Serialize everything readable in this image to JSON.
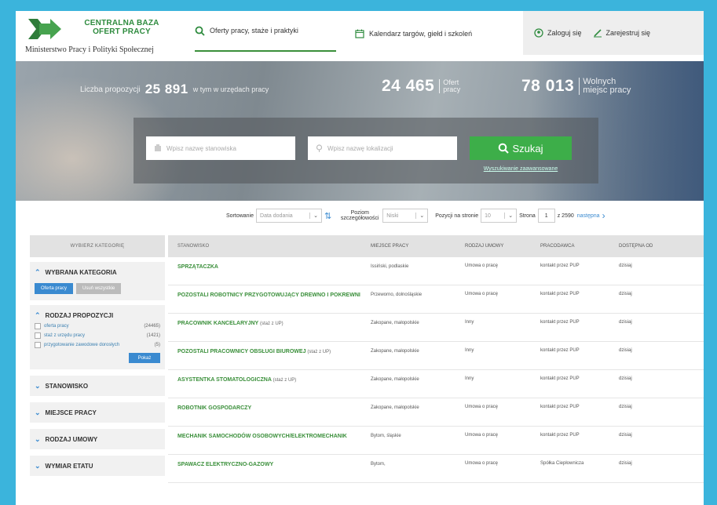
{
  "header": {
    "logo_line1": "CENTRALNA BAZA",
    "logo_line2": "OFERT PRACY",
    "ministry": "Ministerstwo Pracy i Polityki Społecznej",
    "nav_offers": "Oferty pracy, staże i praktyki",
    "nav_calendar": "Kalendarz targów, giełd i szkoleń",
    "login": "Zaloguj się",
    "register": "Zarejestruj się"
  },
  "hero": {
    "count_label": "Liczba propozycji",
    "count_value": "25 891",
    "count_suffix": "w tym w urzędach pracy",
    "offers_value": "24 465",
    "offers_label": "Ofert pracy",
    "vacancies_value": "78 013",
    "vacancies_label": "Wolnych miejsc pracy",
    "search_position_placeholder": "Wpisz nazwę stanowiska",
    "search_location_placeholder": "Wpisz nazwę lokalizacji",
    "search_button": "Szukaj",
    "advanced_search": "Wyszukiwanie zaawansowane"
  },
  "toolbar": {
    "sort_label": "Sortowanie",
    "sort_value": "Data dodania",
    "detail_label": "Poziom szczegółowości",
    "detail_value": "Niski",
    "per_page_label": "Pozycji na stronie",
    "per_page_value": "10",
    "page_label": "Strona",
    "page_value": "1",
    "page_total": "z 2590",
    "next_label": "następna"
  },
  "sidebar": {
    "header": "WYBIERZ KATEGORIĘ",
    "selected_title": "WYBRANA KATEGORIA",
    "clear_label": "Oferta pracy",
    "clear_all_label": "Usuń wszystkie",
    "type_title": "RODZAJ PROPOZYCJI",
    "type_items": [
      {
        "label": "oferta pracy",
        "count": "(24465)"
      },
      {
        "label": "staż z urzędu pracy",
        "count": "(1421)"
      },
      {
        "label": "przygotowanie zawodowe dorosłych",
        "count": "(5)"
      }
    ],
    "show_button": "Pokaż",
    "filters": [
      "STANOWISKO",
      "MIEJSCE PRACY",
      "RODZAJ UMOWY",
      "WYMIAR ETATU"
    ]
  },
  "table": {
    "columns": [
      "STANOWISKO",
      "MIEJSCE PRACY",
      "RODZAJ UMOWY",
      "PRACODAWCA",
      "DOSTĘPNA OD"
    ],
    "rows": [
      {
        "title": "SPRZĄTACZKA",
        "note": "",
        "place": "Issiński, podlaskie",
        "contract": "Umowa o pracę",
        "employer": "kontakt przez PUP",
        "from": "dzisiaj"
      },
      {
        "title": "POZOSTALI ROBOTNICY PRZYGOTOWUJĄCY DREWNO I POKREWNI",
        "note": "",
        "place": "Przeworno, dolnośląskie",
        "contract": "Umowa o pracę",
        "employer": "kontakt przez PUP",
        "from": "dzisiaj"
      },
      {
        "title": "PRACOWNIK KANCELARYJNY",
        "note": "(staż z UP)",
        "place": "Zakopane, małopolskie",
        "contract": "Inny",
        "employer": "kontakt przez PUP",
        "from": "dzisiaj"
      },
      {
        "title": "POZOSTALI PRACOWNICY OBSŁUGI BIUROWEJ",
        "note": "(staż z UP)",
        "place": "Zakopane, małopolskie",
        "contract": "Inny",
        "employer": "kontakt przez PUP",
        "from": "dzisiaj"
      },
      {
        "title": "ASYSTENTKA STOMATOLOGICZNA",
        "note": "(staż z UP)",
        "place": "Zakopane, małopolskie",
        "contract": "Inny",
        "employer": "kontakt przez PUP",
        "from": "dzisiaj"
      },
      {
        "title": "ROBOTNIK GOSPODARCZY",
        "note": "",
        "place": "Zakopane, małopolskie",
        "contract": "Umowa o pracę",
        "employer": "kontakt przez PUP",
        "from": "dzisiaj"
      },
      {
        "title": "MECHANIK SAMOCHODÓW OSOBOWYCH/ELEKTROMECHANIK",
        "note": "",
        "place": "Bytom, śląskie",
        "contract": "Umowa o pracę",
        "employer": "kontakt przez PUP",
        "from": "dzisiaj"
      },
      {
        "title": "SPAWACZ ELEKTRYCZNO-GAZOWY",
        "note": "",
        "place": "Bytom,",
        "contract": "Umowa o pracę",
        "employer": "Spółka Ciepłownicza",
        "from": "dzisiaj"
      }
    ]
  },
  "colors": {
    "accent": "#3dae49",
    "brand_green": "#3a8f3a",
    "link_blue": "#3a8ad0",
    "frame": "#3bb4dc"
  }
}
